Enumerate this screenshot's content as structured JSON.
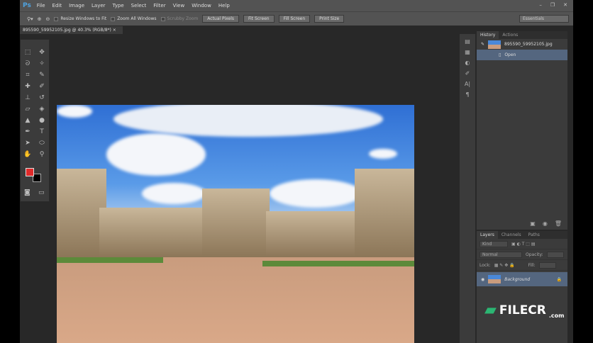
{
  "app": {
    "logo": "Ps"
  },
  "menu": [
    "File",
    "Edit",
    "Image",
    "Layer",
    "Type",
    "Select",
    "Filter",
    "View",
    "Window",
    "Help"
  ],
  "options": {
    "resize_windows": "Resize Windows to Fit",
    "zoom_all": "Zoom All Windows",
    "scrubby_zoom": "Scrubby Zoom",
    "actual_pixels": "Actual Pixels",
    "fit_screen": "Fit Screen",
    "fill_screen": "Fill Screen",
    "print_size": "Print Size",
    "workspace": "Essentials"
  },
  "document": {
    "tab": "895590_59952105.jpg @ 40.3% (RGB/8*)",
    "close": "×"
  },
  "colors": {
    "foreground": "#e02a2a",
    "background": "#000000"
  },
  "history": {
    "tabs": [
      "History",
      "Actions"
    ],
    "snapshot": "895590_59952105.jpg",
    "items": [
      "Open"
    ]
  },
  "layers": {
    "tabs": [
      "Layers",
      "Channels",
      "Paths"
    ],
    "kind": "Kind",
    "blend": "Normal",
    "opacity_label": "Opacity:",
    "lock_label": "Lock:",
    "fill_label": "Fill:",
    "layer_name": "Background"
  },
  "watermark": {
    "text": "FILECR",
    "sub": ".com"
  }
}
